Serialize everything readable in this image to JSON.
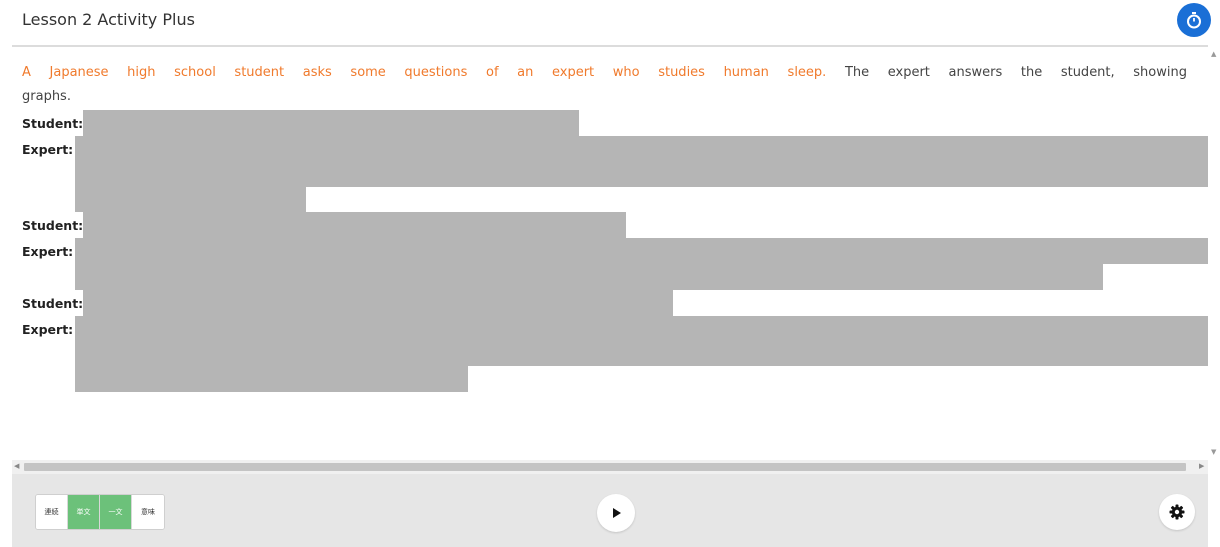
{
  "header": {
    "title": "Lesson 2 Activity Plus",
    "timer_icon": "stopwatch-icon",
    "accent": "#1a6fd6"
  },
  "intro": {
    "orange_part": "A Japanese high school student asks some questions of an expert who studies human sleep.",
    "plain_part": "The expert answers the student, showing graphs.",
    "orange_color": "#f07a2c"
  },
  "dialogue": [
    {
      "speaker": "Student:"
    },
    {
      "speaker": "Expert:"
    },
    {
      "speaker": "Student:"
    },
    {
      "speaker": "Expert:"
    },
    {
      "speaker": "Student:"
    },
    {
      "speaker": "Expert:"
    }
  ],
  "footer": {
    "modes": [
      {
        "label": "連続",
        "active": false
      },
      {
        "label": "単文",
        "active": true
      },
      {
        "label": "一文",
        "active": true
      },
      {
        "label": "意味",
        "active": false
      }
    ],
    "active_color": "#6cc17a",
    "play_icon": "play-icon",
    "settings_icon": "gear-icon"
  }
}
